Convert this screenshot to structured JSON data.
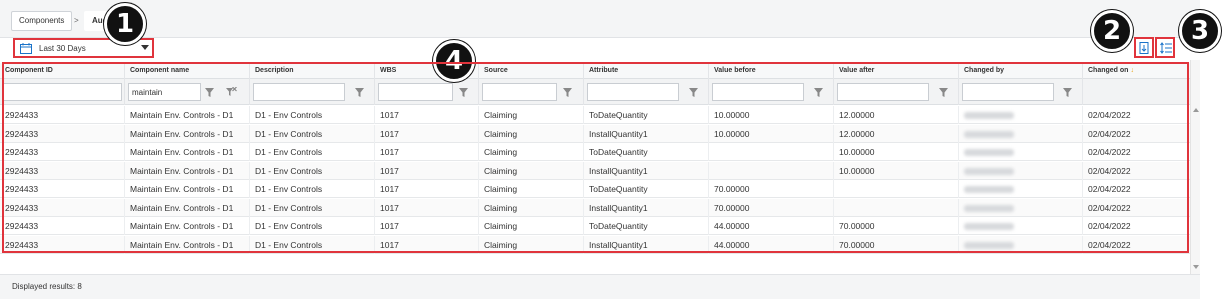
{
  "breadcrumb": {
    "root": "Components",
    "separator": ">",
    "current": "Audit"
  },
  "date_filter": {
    "label": "Last 30 Days"
  },
  "callouts": [
    "1",
    "2",
    "3",
    "4"
  ],
  "columns": [
    {
      "label": "Component ID"
    },
    {
      "label": "Component name"
    },
    {
      "label": "Description"
    },
    {
      "label": "WBS"
    },
    {
      "label": "Source"
    },
    {
      "label": "Attribute"
    },
    {
      "label": "Value before"
    },
    {
      "label": "Value after"
    },
    {
      "label": "Changed by"
    },
    {
      "label": "Changed on"
    }
  ],
  "sort_indicator": "↓",
  "filters": {
    "component_name": "maintain"
  },
  "rows": [
    [
      "2924433",
      "Maintain Env. Controls - D1",
      "D1 - Env Controls",
      "1017",
      "Claiming",
      "ToDateQuantity",
      "10.00000",
      "12.00000",
      "02/04/2022"
    ],
    [
      "2924433",
      "Maintain Env. Controls - D1",
      "D1 - Env Controls",
      "1017",
      "Claiming",
      "InstallQuantity1",
      "10.00000",
      "12.00000",
      "02/04/2022"
    ],
    [
      "2924433",
      "Maintain Env. Controls - D1",
      "D1 - Env Controls",
      "1017",
      "Claiming",
      "ToDateQuantity",
      "",
      "10.00000",
      "02/04/2022"
    ],
    [
      "2924433",
      "Maintain Env. Controls - D1",
      "D1 - Env Controls",
      "1017",
      "Claiming",
      "InstallQuantity1",
      "",
      "10.00000",
      "02/04/2022"
    ],
    [
      "2924433",
      "Maintain Env. Controls - D1",
      "D1 - Env Controls",
      "1017",
      "Claiming",
      "ToDateQuantity",
      "70.00000",
      "",
      "02/04/2022"
    ],
    [
      "2924433",
      "Maintain Env. Controls - D1",
      "D1 - Env Controls",
      "1017",
      "Claiming",
      "InstallQuantity1",
      "70.00000",
      "",
      "02/04/2022"
    ],
    [
      "2924433",
      "Maintain Env. Controls - D1",
      "D1 - Env Controls",
      "1017",
      "Claiming",
      "ToDateQuantity",
      "44.00000",
      "70.00000",
      "02/04/2022"
    ],
    [
      "2924433",
      "Maintain Env. Controls - D1",
      "D1 - Env Controls",
      "1017",
      "Claiming",
      "InstallQuantity1",
      "44.00000",
      "70.00000",
      "02/04/2022"
    ]
  ],
  "footer": {
    "label": "Displayed results: 8"
  },
  "colors": {
    "highlight": "#e0343c",
    "accent": "#1a73c9",
    "sort": "#e8a317"
  },
  "icons": [
    "calendar-icon",
    "caret-down-icon",
    "export-icon",
    "column-settings-icon",
    "filter-icon",
    "clear-filter-icon"
  ]
}
